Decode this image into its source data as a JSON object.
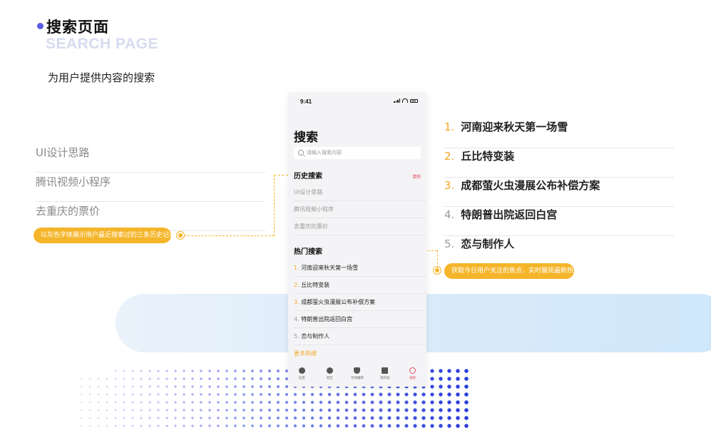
{
  "header": {
    "title": "搜索页面",
    "subtitle": "SEARCH PAGE",
    "description": "为用户提供内容的搜索"
  },
  "left_history": {
    "items": [
      "UI设计思路",
      "腾讯视频小程序",
      "去重庆的票价"
    ],
    "callout": "以灰色字体展示用户最近搜索过的三条历史记录"
  },
  "right_hot": {
    "items": [
      {
        "num": "1.",
        "text": "河南迎来秋天第一场雪"
      },
      {
        "num": "2.",
        "text": "丘比特变装"
      },
      {
        "num": "3.",
        "text": "成都萤火虫漫展公布补偿方案"
      },
      {
        "num": "4.",
        "text": "特朗普出院返回白宫"
      },
      {
        "num": "5.",
        "text": "恋与制作人"
      }
    ],
    "callout": "获取今日用户关注的焦点，实时展现最新热点"
  },
  "phone": {
    "time": "9:41",
    "title": "搜索",
    "search_placeholder": "请输入搜索内容",
    "history_title": "历史搜索",
    "clear_label": "清除",
    "history_items": [
      "UI设计思路",
      "腾讯视频小程序",
      "去重庆的票价"
    ],
    "hot_title": "热门搜索",
    "hot_items": [
      {
        "num": "1.",
        "text": "河南迎来秋天第一场雪"
      },
      {
        "num": "2.",
        "text": "丘比特变装"
      },
      {
        "num": "3.",
        "text": "成都萤火虫漫展公布补偿方案"
      },
      {
        "num": "4.",
        "text": "特朗普出院返回白宫"
      },
      {
        "num": "5.",
        "text": "恋与制作人"
      }
    ],
    "more_label": "更多热搜",
    "tabs": [
      {
        "label": "信息",
        "icon": "chat-icon"
      },
      {
        "label": "社区",
        "icon": "compass-icon"
      },
      {
        "label": "为你推荐",
        "icon": "heart-icon"
      },
      {
        "label": "资料馆",
        "icon": "archive-icon"
      },
      {
        "label": "搜索",
        "icon": "search-icon"
      }
    ]
  },
  "colors": {
    "accent_orange": "#f5a623",
    "callout_orange": "#f5b52a",
    "header_dot": "#5b5be8",
    "subtitle": "#d6dbef",
    "active_tab": "#e84a5f"
  }
}
